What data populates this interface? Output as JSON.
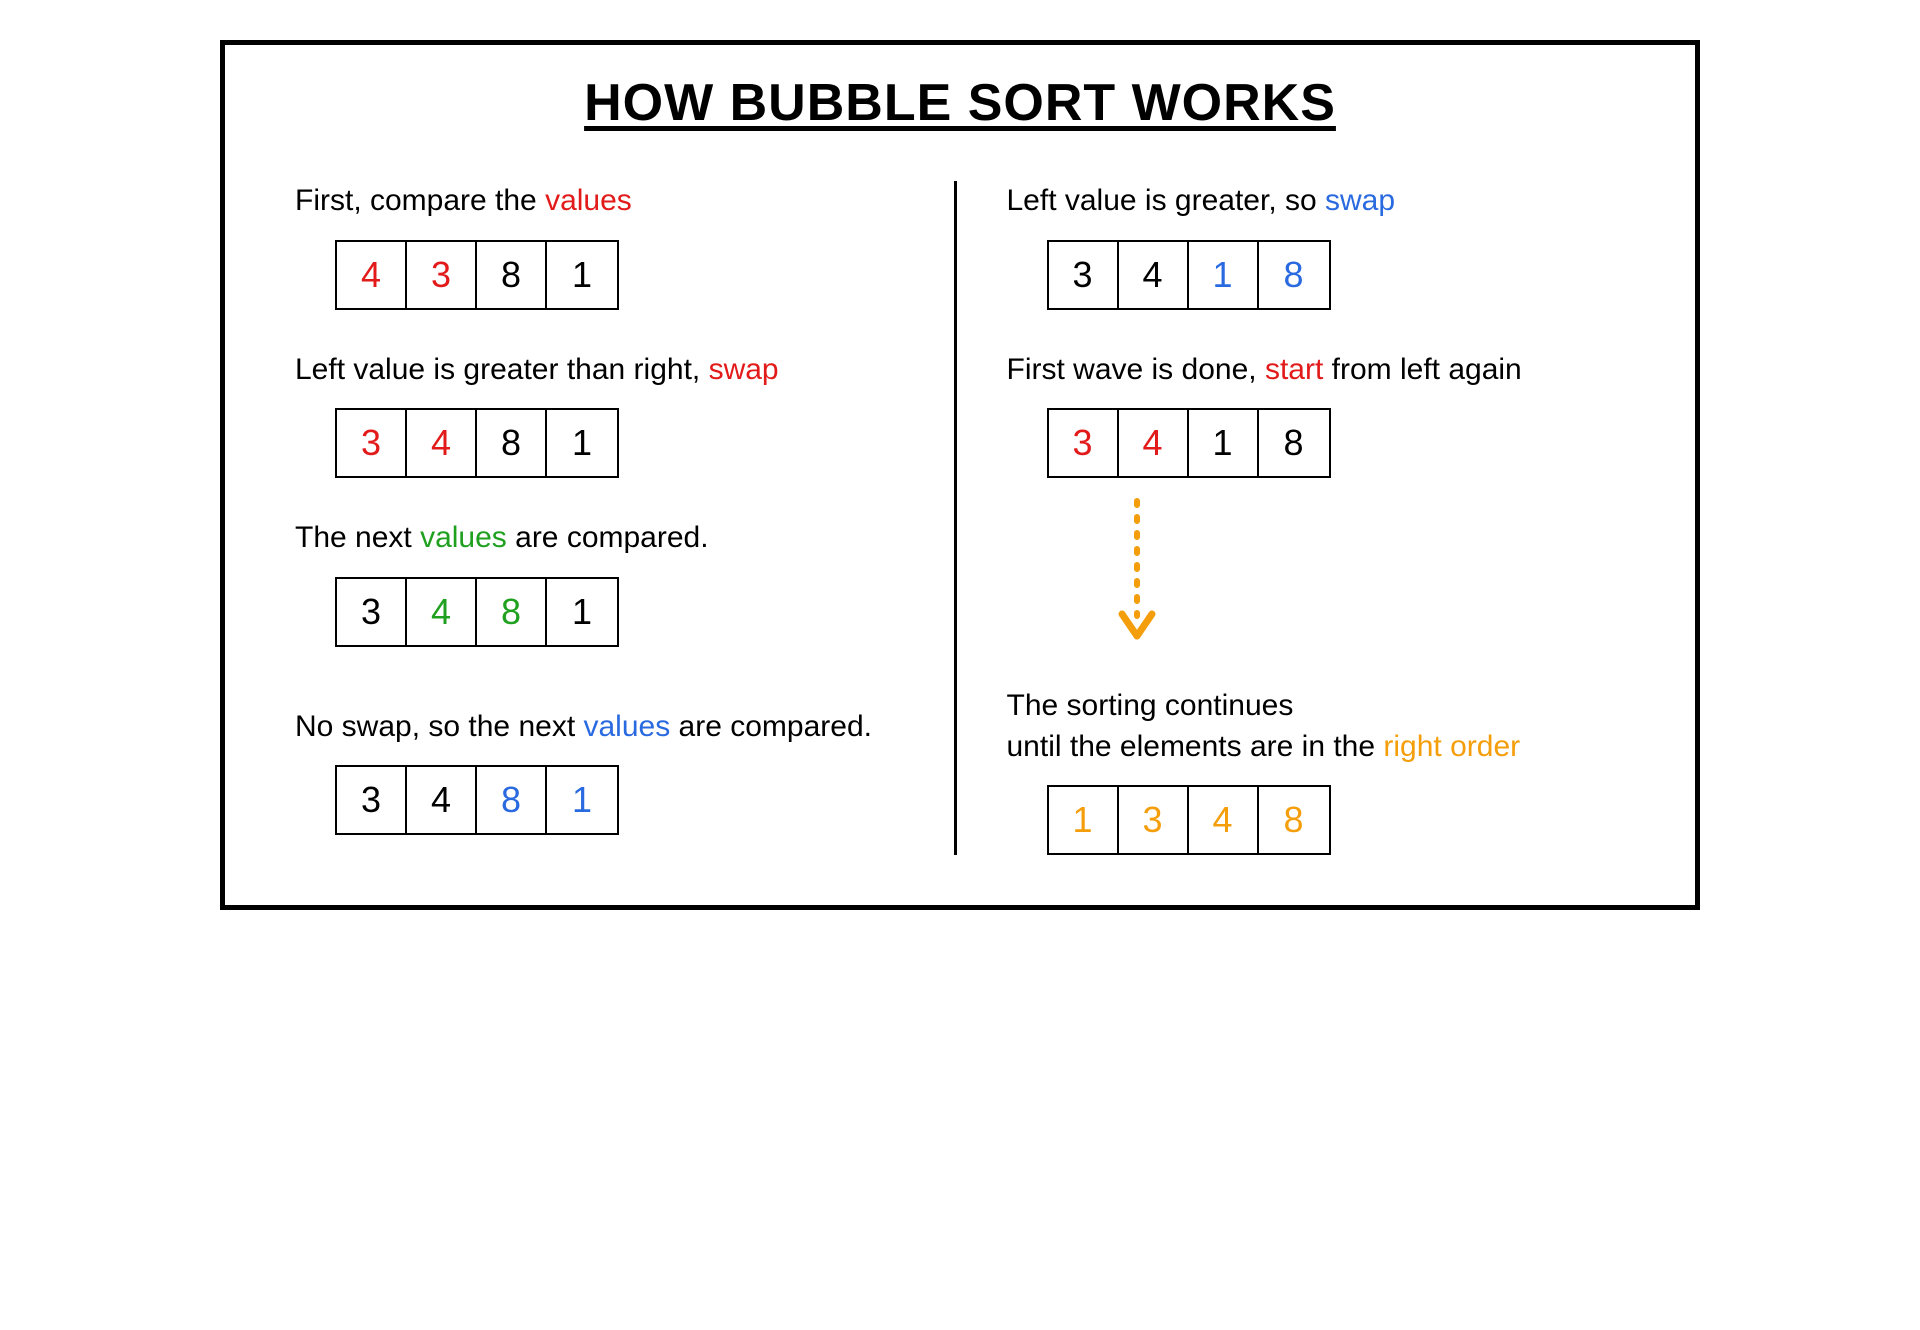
{
  "title": "HOW BUBBLE SORT WORKS",
  "colors": {
    "red": "#e21a1a",
    "green": "#1fa01f",
    "blue": "#2a6ae0",
    "orange": "#f59e0b",
    "black": "#000000"
  },
  "steps": {
    "s1": {
      "caption_parts": [
        {
          "text": "First, compare the ",
          "color": "black"
        },
        {
          "text": "values",
          "color": "red"
        }
      ],
      "cells": [
        {
          "v": "4",
          "color": "red"
        },
        {
          "v": "3",
          "color": "red"
        },
        {
          "v": "8",
          "color": "black"
        },
        {
          "v": "1",
          "color": "black"
        }
      ]
    },
    "s2": {
      "caption_parts": [
        {
          "text": "Left value is greater than right, ",
          "color": "black"
        },
        {
          "text": "swap",
          "color": "red"
        }
      ],
      "cells": [
        {
          "v": "3",
          "color": "red"
        },
        {
          "v": "4",
          "color": "red"
        },
        {
          "v": "8",
          "color": "black"
        },
        {
          "v": "1",
          "color": "black"
        }
      ]
    },
    "s3": {
      "caption_parts": [
        {
          "text": "The next ",
          "color": "black"
        },
        {
          "text": "values",
          "color": "green"
        },
        {
          "text": " are compared.",
          "color": "black"
        }
      ],
      "cells": [
        {
          "v": "3",
          "color": "black"
        },
        {
          "v": "4",
          "color": "green"
        },
        {
          "v": "8",
          "color": "green"
        },
        {
          "v": "1",
          "color": "black"
        }
      ]
    },
    "s4": {
      "caption_parts": [
        {
          "text": "No swap, so the next ",
          "color": "black"
        },
        {
          "text": "values",
          "color": "blue"
        },
        {
          "text": " are compared.",
          "color": "black"
        }
      ],
      "cells": [
        {
          "v": "3",
          "color": "black"
        },
        {
          "v": "4",
          "color": "black"
        },
        {
          "v": "8",
          "color": "blue"
        },
        {
          "v": "1",
          "color": "blue"
        }
      ]
    },
    "s5": {
      "caption_parts": [
        {
          "text": "Left value is greater, so ",
          "color": "black"
        },
        {
          "text": "swap",
          "color": "blue"
        }
      ],
      "cells": [
        {
          "v": "3",
          "color": "black"
        },
        {
          "v": "4",
          "color": "black"
        },
        {
          "v": "1",
          "color": "blue"
        },
        {
          "v": "8",
          "color": "blue"
        }
      ]
    },
    "s6": {
      "caption_parts": [
        {
          "text": "First wave is done, ",
          "color": "black"
        },
        {
          "text": "start",
          "color": "red"
        },
        {
          "text": " from left again",
          "color": "black"
        }
      ],
      "cells": [
        {
          "v": "3",
          "color": "red"
        },
        {
          "v": "4",
          "color": "red"
        },
        {
          "v": "1",
          "color": "black"
        },
        {
          "v": "8",
          "color": "black"
        }
      ]
    },
    "s7": {
      "caption_parts": [
        {
          "text": "The sorting continues",
          "color": "black"
        },
        {
          "text": "\n",
          "color": "black"
        },
        {
          "text": "until the elements are in the ",
          "color": "black"
        },
        {
          "text": "right order",
          "color": "orange"
        }
      ],
      "cells": [
        {
          "v": "1",
          "color": "orange"
        },
        {
          "v": "3",
          "color": "orange"
        },
        {
          "v": "4",
          "color": "orange"
        },
        {
          "v": "8",
          "color": "orange"
        }
      ]
    }
  }
}
